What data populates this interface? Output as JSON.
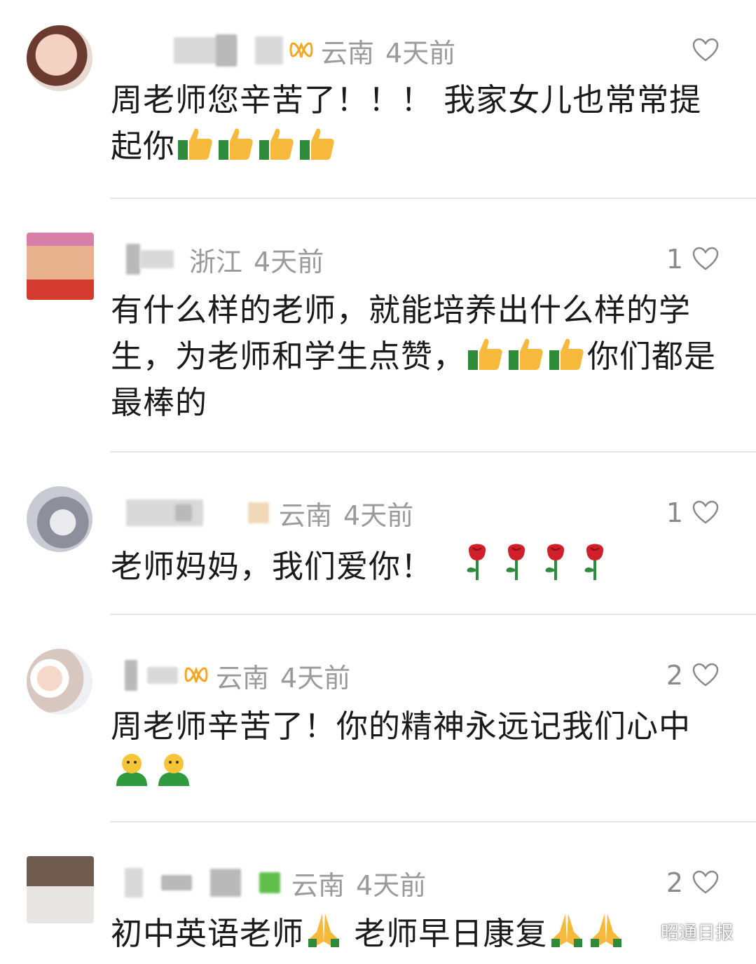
{
  "comments": [
    {
      "location": "云南",
      "time": "4天前",
      "likes": "",
      "text": "周老师您辛苦了！！！ 我家女儿也常常提起你",
      "emoji": [
        "thumbs-up",
        "thumbs-up",
        "thumbs-up",
        "thumbs-up"
      ]
    },
    {
      "location": "浙江",
      "time": "4天前",
      "likes": "1",
      "text_a": "有什么样的老师，就能培养出什么样的学生，为老师和学生点赞，",
      "text_b": "你们都是最棒的",
      "emoji": [
        "thumbs-up",
        "thumbs-up",
        "thumbs-up"
      ]
    },
    {
      "location": "云南",
      "time": "4天前",
      "likes": "1",
      "text": "老师妈妈，我们爱你！",
      "emoji": [
        "rose",
        "rose",
        "rose",
        "rose"
      ]
    },
    {
      "location": "云南",
      "time": "4天前",
      "likes": "2",
      "text": "周老师辛苦了！你的精神永远记我们心中",
      "emoji": [
        "smiley-person",
        "smiley-person"
      ]
    },
    {
      "location": "云南",
      "time": "4天前",
      "likes": "2",
      "text_a": "初中英语老师",
      "text_b": "老师早日康复",
      "emoji": [
        "praying-hands",
        "praying-hands",
        "praying-hands"
      ]
    }
  ],
  "watermark": {
    "text": "昭通日报"
  },
  "colors": {
    "badge": "#f5a623",
    "meta": "#9a9a9a",
    "divider": "#e6e6e6"
  }
}
